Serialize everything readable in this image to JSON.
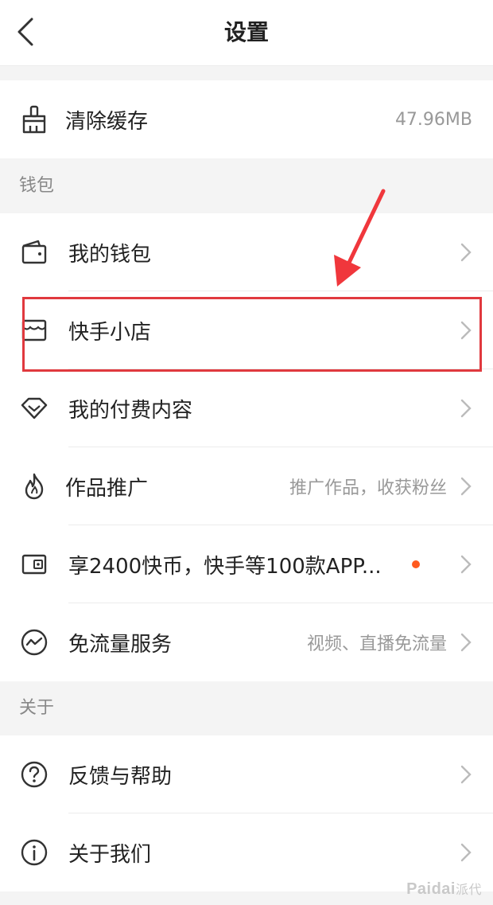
{
  "header": {
    "title": "设置"
  },
  "storage": {
    "clear_cache": {
      "label": "清除缓存",
      "value": "47.96MB"
    }
  },
  "wallet_section": {
    "title": "钱包",
    "items": [
      {
        "label": "我的钱包",
        "icon": "wallet-icon"
      },
      {
        "label": "快手小店",
        "icon": "shop-icon"
      },
      {
        "label": "我的付费内容",
        "icon": "diamond-icon"
      },
      {
        "label": "作品推广",
        "icon": "flame-icon",
        "hint": "推广作品，收获粉丝"
      },
      {
        "label": "享2400快币，快手等100款APP...",
        "icon": "coin-card-icon",
        "has_dot": true
      },
      {
        "label": "免流量服务",
        "icon": "traffic-icon",
        "hint": "视频、直播免流量"
      }
    ]
  },
  "about_section": {
    "title": "关于",
    "items": [
      {
        "label": "反馈与帮助",
        "icon": "help-icon"
      },
      {
        "label": "关于我们",
        "icon": "info-icon"
      }
    ]
  },
  "watermark": {
    "brand": "Paidai",
    "suffix": "派代"
  },
  "colors": {
    "highlight": "#e0393e",
    "arrow": "#f0373c",
    "dot": "#ff5a1f"
  }
}
